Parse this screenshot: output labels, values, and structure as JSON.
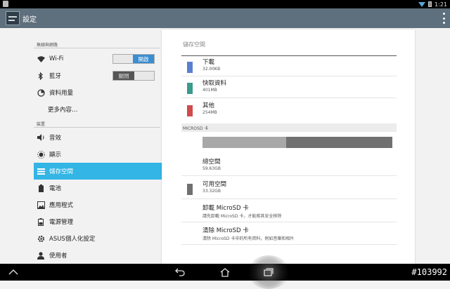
{
  "statusbar": {
    "time": "1:21"
  },
  "actionbar": {
    "title": "設定"
  },
  "sidebar": {
    "section_wireless": "無線與網路",
    "section_device": "裝置",
    "items": [
      {
        "label": "Wi-Fi",
        "icon": "wifi-icon",
        "toggle": "開啟"
      },
      {
        "label": "藍牙",
        "icon": "bluetooth-icon",
        "toggle": "關閉"
      },
      {
        "label": "資料用量",
        "icon": "data-usage-icon"
      },
      {
        "label": "更多內容…"
      },
      {
        "label": "音效",
        "icon": "sound-icon"
      },
      {
        "label": "顯示",
        "icon": "display-icon"
      },
      {
        "label": "儲存空間",
        "icon": "storage-icon",
        "selected": true
      },
      {
        "label": "電池",
        "icon": "battery-icon"
      },
      {
        "label": "應用程式",
        "icon": "apps-icon"
      },
      {
        "label": "電源管理",
        "icon": "power-management-icon"
      },
      {
        "label": "ASUS個人化設定",
        "icon": "gear-icon"
      },
      {
        "label": "使用者",
        "icon": "user-icon"
      }
    ]
  },
  "panel": {
    "title": "儲存空間",
    "internal": [
      {
        "name": "下載",
        "value": "32.00KB",
        "color": "#5b7fd0"
      },
      {
        "name": "快取資料",
        "value": "401MB",
        "color": "#3a9a8c"
      },
      {
        "name": "其他",
        "value": "254MB",
        "color": "#d04b4b"
      }
    ],
    "microsd_header": "MICROSD 卡",
    "microsd_used_fraction": 0.44,
    "total": {
      "name": "總空間",
      "value": "59.63GB"
    },
    "available": {
      "name": "可用空間",
      "value": "33.32GB",
      "color": "#707070"
    },
    "unmount": {
      "title": "卸載 MicroSD 卡",
      "subtitle": "請先卸載 MicroSD 卡，才能將其安全移除"
    },
    "erase": {
      "title": "清除 MicroSD 卡",
      "subtitle": "清除 MicroSD 卡中的所有資料，例如音樂和相片"
    }
  },
  "navbar": {
    "watermark": "#103992"
  }
}
